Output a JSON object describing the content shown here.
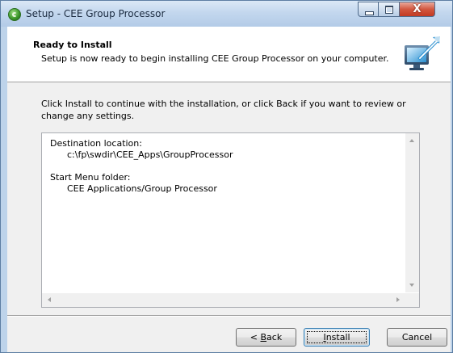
{
  "window": {
    "title": "Setup - CEE Group Processor",
    "minimize_icon": "minimize-icon",
    "maximize_icon": "maximize-icon",
    "close_icon": "close-icon",
    "close_glyph": "X"
  },
  "header": {
    "title": "Ready to Install",
    "subtitle": "Setup is now ready to begin installing CEE Group Processor on your computer.",
    "icon": "setup-computer-icon"
  },
  "body": {
    "instruction": "Click Install to continue with the installation, or click Back if you want to review or change any settings.",
    "summary": {
      "destination_label": "Destination location:",
      "destination_value": "c:\\fp\\swdir\\CEE_Apps\\GroupProcessor",
      "start_menu_label": "Start Menu folder:",
      "start_menu_value": "CEE Applications/Group Processor"
    }
  },
  "buttons": {
    "back_lt": "< ",
    "back_accel": "B",
    "back_rest": "ack",
    "install_accel": "I",
    "install_rest": "nstall",
    "cancel": "Cancel"
  },
  "colors": {
    "titlebar": "#c3d7ee",
    "close_button": "#c23a22",
    "dialog_bg": "#f0f0f0"
  }
}
